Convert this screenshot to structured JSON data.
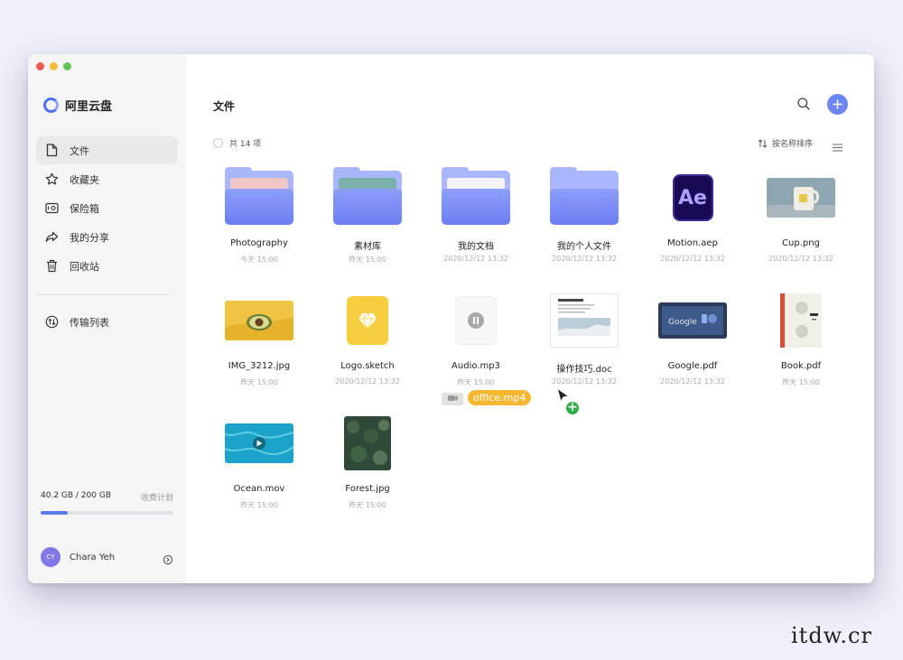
{
  "app": {
    "name": "阿里云盘"
  },
  "sidebar": {
    "items": [
      {
        "label": "文件",
        "icon": "file-icon",
        "active": true
      },
      {
        "label": "收藏夹",
        "icon": "star-icon",
        "active": false
      },
      {
        "label": "保险箱",
        "icon": "safe-icon",
        "active": false
      },
      {
        "label": "我的分享",
        "icon": "share-icon",
        "active": false
      },
      {
        "label": "回收站",
        "icon": "trash-icon",
        "active": false
      }
    ],
    "transfer": {
      "label": "传输列表",
      "icon": "transfer-icon"
    }
  },
  "storage": {
    "used": "40.2 GB / 200 GB",
    "plan": "收费计划",
    "fraction": 0.201
  },
  "user": {
    "initials": "CY",
    "name": "Chara Yeh"
  },
  "header": {
    "title": "文件"
  },
  "toolbar": {
    "count": "共 14 项",
    "sort": "按名称排序"
  },
  "files": [
    {
      "name": "Photography",
      "date": "今天 15:00",
      "kind": "folder",
      "paper": "#f0c6c6"
    },
    {
      "name": "素材库",
      "date": "昨天 15:00",
      "kind": "folder",
      "paper": "#7bb0ac"
    },
    {
      "name": "我的文档",
      "date": "2020/12/12 13:32",
      "kind": "folder",
      "paper": "#f4f4f8"
    },
    {
      "name": "我的个人文件",
      "date": "2020/12/12 13:32",
      "kind": "folder",
      "paper": ""
    },
    {
      "name": "Motion.aep",
      "date": "2020/12/12 13:32",
      "kind": "ae",
      "glyph": "Ae"
    },
    {
      "name": "Cup.png",
      "date": "2020/12/12 13:32",
      "kind": "cup"
    },
    {
      "name": "IMG_3212.jpg",
      "date": "昨天 15:00",
      "kind": "avocado"
    },
    {
      "name": "Logo.sketch",
      "date": "2020/12/12 13:32",
      "kind": "sketch"
    },
    {
      "name": "Audio.mp3",
      "date": "昨天 15:00",
      "kind": "audio"
    },
    {
      "name": "操作技巧.doc",
      "date": "2020/12/12 13:32",
      "kind": "doc"
    },
    {
      "name": "Google.pdf",
      "date": "2020/12/12 13:32",
      "kind": "google"
    },
    {
      "name": "Book.pdf",
      "date": "昨天 15:00",
      "kind": "book"
    },
    {
      "name": "Ocean.mov",
      "date": "昨天 15:00",
      "kind": "ocean"
    },
    {
      "name": "Forest.jpg",
      "date": "昨天 15:00",
      "kind": "forest"
    }
  ],
  "drag": {
    "label": "office.mp4"
  },
  "colors": {
    "accent": "#5b78f0",
    "folder": "#8d9ff9",
    "drag_badge": "#f5b731",
    "add_green": "#2eae4a"
  },
  "watermark": "itdw.cr"
}
